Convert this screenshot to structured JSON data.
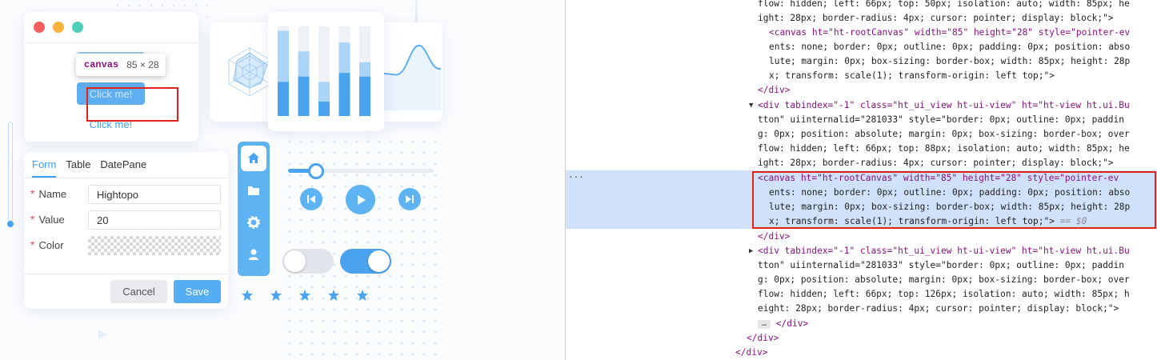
{
  "showcase": {
    "window_controls": [
      "close",
      "minimize",
      "maximize"
    ],
    "buttons": [
      {
        "label": "Click me!",
        "state": "disabled"
      },
      {
        "label": "Click me!",
        "state": "inspected"
      },
      {
        "label": "Click me!",
        "state": "link"
      }
    ],
    "tooltip": {
      "tag": "canvas",
      "size": "85 × 28"
    },
    "bar_chart": {
      "levels": [
        0.95,
        0.72,
        0.38,
        0.82,
        0.6
      ],
      "highlight_levels": [
        0.38,
        0.44,
        0.16,
        0.48,
        0.44
      ]
    },
    "form": {
      "tabs": [
        {
          "label": "Form"
        },
        {
          "label": "Table"
        },
        {
          "label": "DatePane"
        }
      ],
      "active_tab": "Form",
      "fields": [
        {
          "label": "Name",
          "value": "Hightopo"
        },
        {
          "label": "Value",
          "value": "20"
        },
        {
          "label": "Color",
          "value": ""
        }
      ],
      "required_marker": "*",
      "cancel_label": "Cancel",
      "save_label": "Save"
    },
    "nav_icons": [
      "home-icon",
      "folder-icon",
      "gear-icon",
      "user-icon"
    ],
    "slider_level": 0.2,
    "media_controls": [
      "prev-icon",
      "play-icon",
      "next-icon"
    ],
    "toggles": [
      {
        "state": "off"
      },
      {
        "state": "on"
      }
    ],
    "rating": {
      "stars": 5
    },
    "accent_color": "#4aa3ef"
  },
  "devtools": {
    "lines": [
      {
        "text": "flow: hidden; left: 66px; top: 50px; isolation: auto; width: 85px; he"
      },
      {
        "text": "ight: 28px; border-radius: 4px; cursor: pointer; display: block;\">"
      },
      {
        "text": "<canvas ht=\"ht-rootCanvas\" width=\"85\" height=\"28\" style=\"pointer-ev"
      },
      {
        "text": "ents: none; border: 0px; outline: 0px; padding: 0px; position: abso"
      },
      {
        "text": "lute; margin: 0px; box-sizing: border-box; width: 85px; height: 28p"
      },
      {
        "text": "x; transform: scale(1); transform-origin: left top;\">"
      },
      {
        "text": "</div>"
      },
      {
        "text": "<div tabindex=\"-1\" class=\"ht_ui_view ht-ui-view\" ht=\"ht-view ht.ui.Bu"
      },
      {
        "text": "tton\" uiinternalid=\"281033\" style=\"border: 0px; outline: 0px; paddin"
      },
      {
        "text": "g: 0px; position: absolute; margin: 0px; box-sizing: border-box; over"
      },
      {
        "text": "flow: hidden; left: 66px; top: 88px; isolation: auto; width: 85px; he"
      },
      {
        "text": "ight: 28px; border-radius: 4px; cursor: pointer; display: block;\">"
      },
      {
        "text": "<canvas ht=\"ht-rootCanvas\" width=\"85\" height=\"28\" style=\"pointer-ev"
      },
      {
        "text": "ents: none; border: 0px; outline: 0px; padding: 0px; position: abso"
      },
      {
        "text": "lute; margin: 0px; box-sizing: border-box; width: 85px; height: 28p"
      },
      {
        "text": "x; transform: scale(1); transform-origin: left top;\">"
      },
      {
        "text": "</div>"
      },
      {
        "text": "<div tabindex=\"-1\" class=\"ht_ui_view ht-ui-view\" ht=\"ht-view ht.ui.Bu"
      },
      {
        "text": "tton\" uiinternalid=\"281033\" style=\"border: 0px; outline: 0px; paddin"
      },
      {
        "text": "g: 0px; position: absolute; margin: 0px; box-sizing: border-box; over"
      },
      {
        "text": "flow: hidden; left: 66px; top: 126px; isolation: auto; width: 85px; h"
      },
      {
        "text": "eight: 28px; border-radius: 4px; cursor: pointer; display: block;\">"
      },
      {
        "text": "</div>"
      },
      {
        "text": "</div>"
      },
      {
        "text": "</div>"
      }
    ],
    "selected_suffix": " == $0",
    "row_marker": "..."
  }
}
